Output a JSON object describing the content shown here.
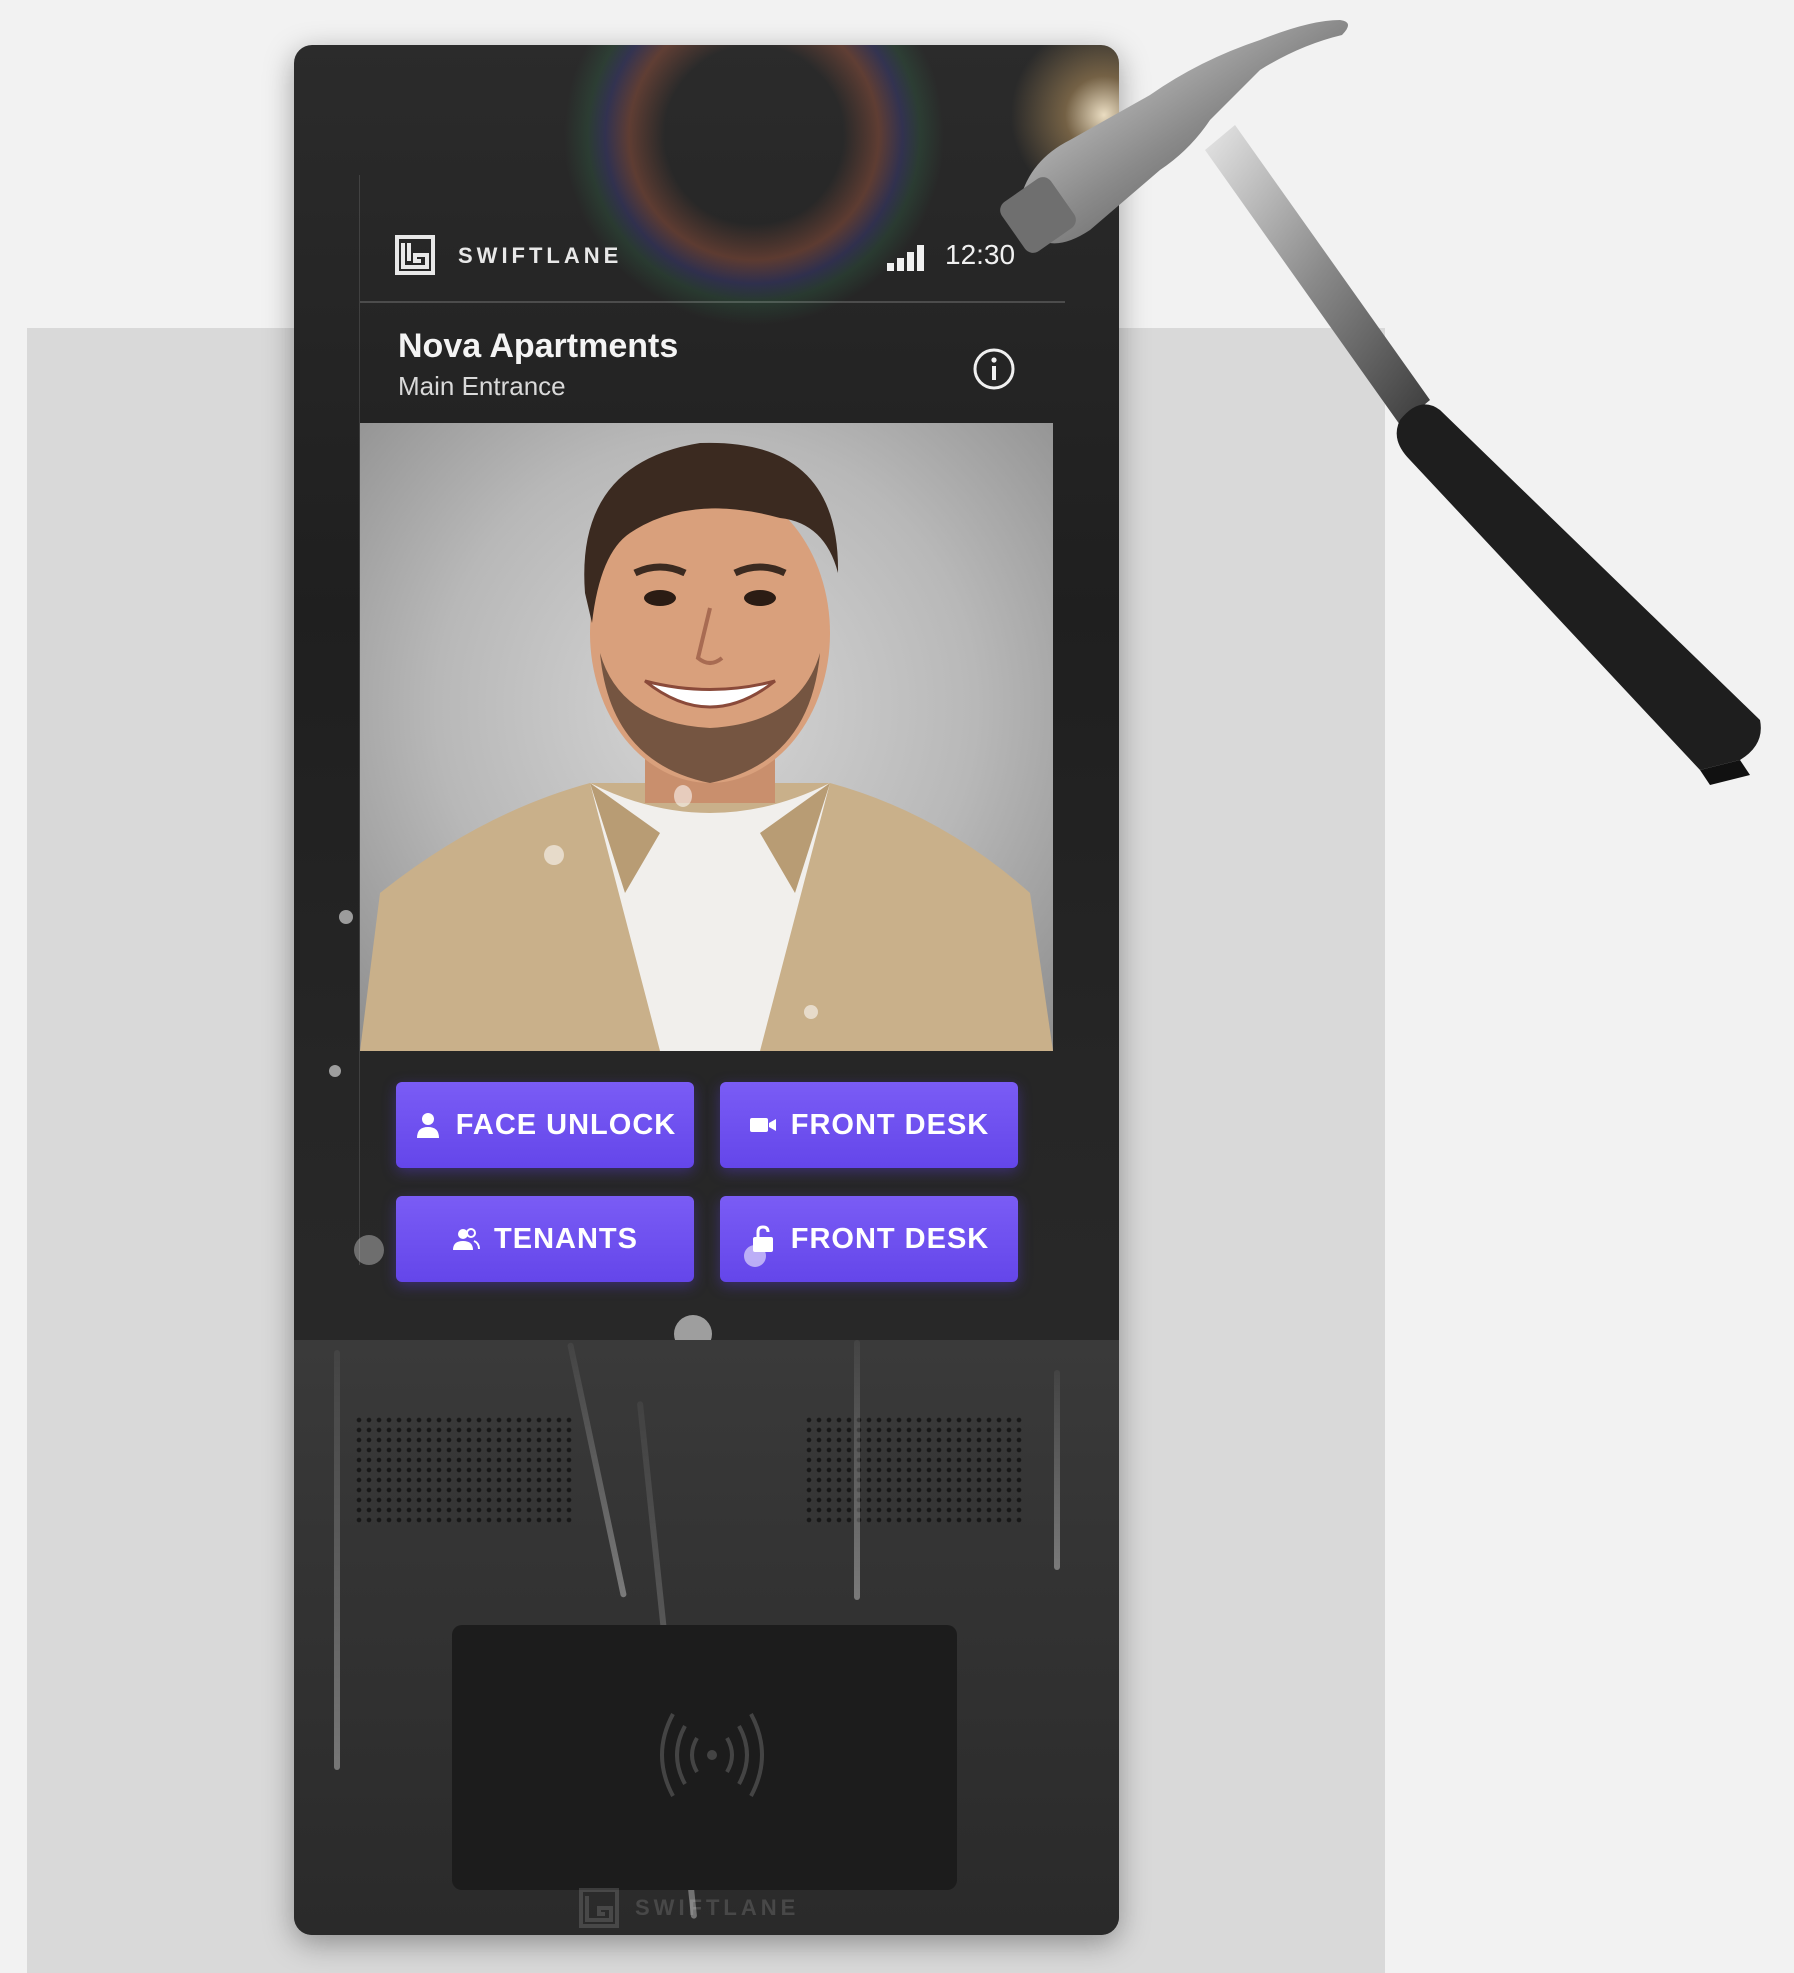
{
  "kiosk": {
    "brand": "SWIFTLANE",
    "time": "12:30",
    "location_name": "Nova Apartments",
    "location_entrance": "Main Entrance",
    "bottom_brand": "SWIFTLANE"
  },
  "actions": [
    {
      "label": "FACE UNLOCK",
      "icon": "person-icon"
    },
    {
      "label": "FRONT DESK",
      "icon": "video-camera-icon"
    },
    {
      "label": "TENANTS",
      "icon": "people-icon"
    },
    {
      "label": "FRONT DESK",
      "icon": "unlock-icon"
    }
  ],
  "colors": {
    "button": "#6a4cf0",
    "device": "#262626",
    "background": "#f2f2f2"
  }
}
